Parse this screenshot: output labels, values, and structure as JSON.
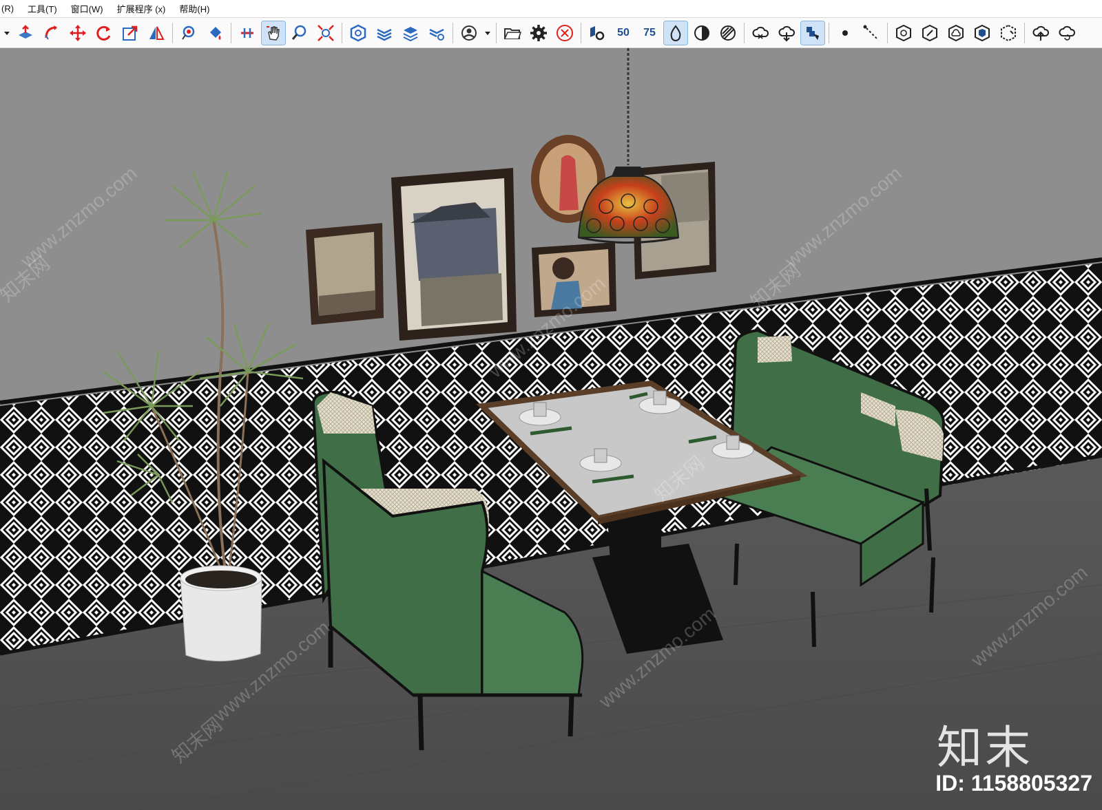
{
  "menubar": {
    "items": [
      "(R)",
      "工具(T)",
      "窗口(W)",
      "扩展程序 (x)",
      "帮助(H)"
    ]
  },
  "toolbar": {
    "label_50": "50",
    "label_75": "75"
  },
  "overlay": {
    "brand": "知末",
    "id_text": "ID: 1158805327",
    "watermark_url": "www.znzmo.com",
    "watermark_cn": "知末网"
  }
}
